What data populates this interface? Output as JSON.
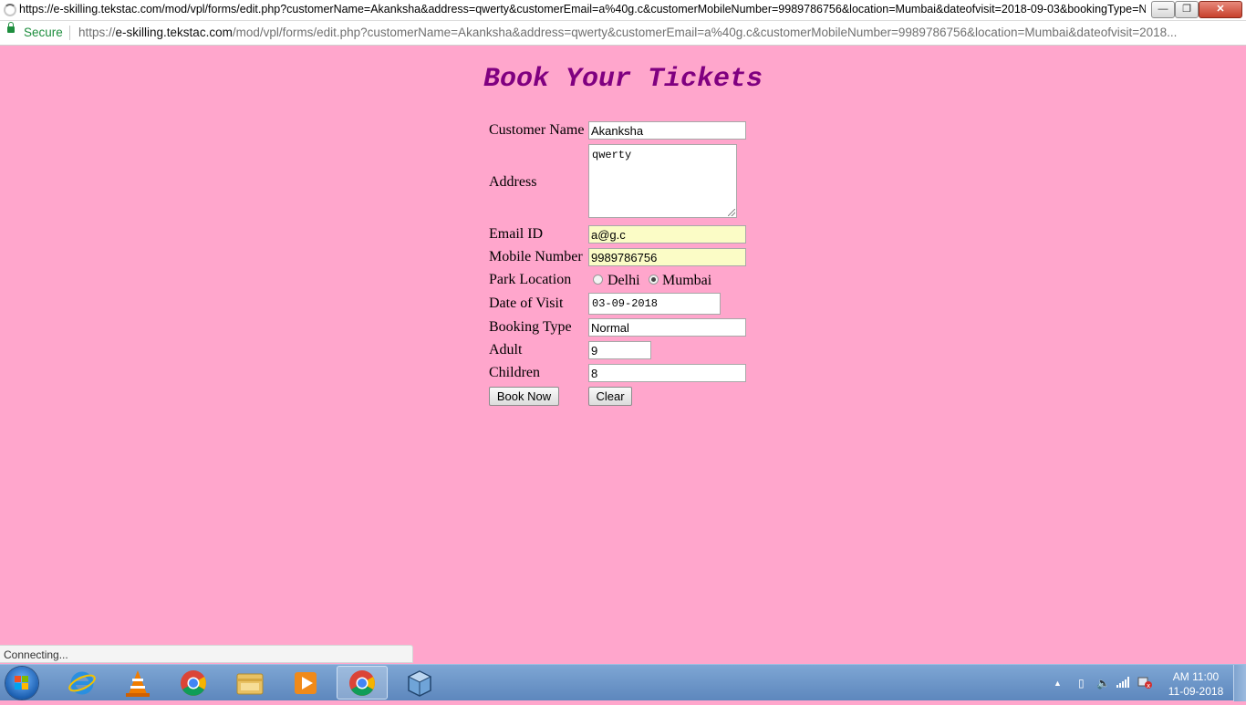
{
  "window": {
    "title": "https://e-skilling.tekstac.com/mod/vpl/forms/edit.php?customerName=Akanksha&address=qwerty&customerEmail=a%40g.c&customerMobileNumber=9989786756&location=Mumbai&dateofvisit=2018-09-03&bookingType=No..."
  },
  "addressbar": {
    "secure_label": "Secure",
    "url_scheme": "https://",
    "url_host": "e-skilling.tekstac.com",
    "url_rest": "/mod/vpl/forms/edit.php?customerName=Akanksha&address=qwerty&customerEmail=a%40g.c&customerMobileNumber=9989786756&location=Mumbai&dateofvisit=2018..."
  },
  "page": {
    "title": "Book Your Tickets",
    "title_color": "#800080",
    "background_color": "#ffa6cc"
  },
  "form": {
    "customer_name": {
      "label": "Customer Name",
      "value": "Akanksha"
    },
    "address": {
      "label": "Address",
      "value": "qwerty"
    },
    "email": {
      "label": "Email ID",
      "value": "a@g.c"
    },
    "mobile": {
      "label": "Mobile Number",
      "value": "9989786756"
    },
    "location": {
      "label": "Park Location",
      "options": [
        "Delhi",
        "Mumbai"
      ],
      "selected": "Mumbai"
    },
    "date_of_visit": {
      "label": "Date of Visit",
      "value": "03-09-2018"
    },
    "booking_type": {
      "label": "Booking Type",
      "value": "Normal"
    },
    "adult": {
      "label": "Adult",
      "value": "9"
    },
    "children": {
      "label": "Children",
      "value": "8"
    },
    "book_now_label": "Book Now",
    "clear_label": "Clear"
  },
  "statusbar": {
    "text": "Connecting..."
  },
  "taskbar": {
    "apps": [
      "start-icon",
      "internet-explorer-icon",
      "vlc-icon",
      "chrome-icon",
      "file-explorer-icon",
      "media-player-icon",
      "chrome-icon",
      "virtualbox-icon"
    ],
    "clock_time": "AM 11:00",
    "clock_date": "11-09-2018"
  }
}
